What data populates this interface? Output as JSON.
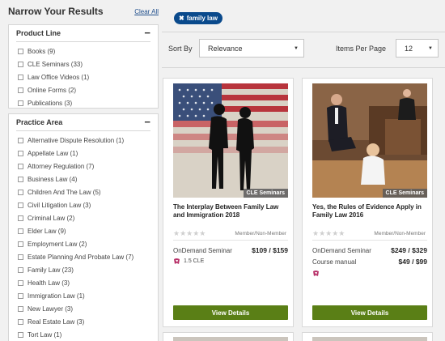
{
  "sidebar": {
    "title": "Narrow Your Results",
    "clear_all": "Clear All",
    "product_line": {
      "title": "Product Line",
      "items": [
        "Books (9)",
        "CLE Seminars (33)",
        "Law Office Videos (1)",
        "Online Forms (2)",
        "Publications (3)"
      ]
    },
    "practice_area": {
      "title": "Practice Area",
      "items": [
        "Alternative Dispute Resolution (1)",
        "Appellate Law (1)",
        "Attorney Regulation (7)",
        "Business Law (4)",
        "Children And The Law (5)",
        "Civil Litigation Law (3)",
        "Criminal Law (2)",
        "Elder Law (9)",
        "Employment Law (2)",
        "Estate Planning And Probate Law (7)",
        "Family Law (23)",
        "Health Law (3)",
        "Immigration Law (1)",
        "New Lawyer (3)",
        "Real Estate Law (3)",
        "Tort Law (1)"
      ]
    }
  },
  "filter_chip": {
    "label": "family law",
    "icon": "close-icon"
  },
  "toolbar": {
    "sort_label": "Sort By",
    "sort_value": "Relevance",
    "ipp_label": "Items Per Page",
    "ipp_value": "12"
  },
  "cards": [
    {
      "badge": "CLE Seminars",
      "title": "The Interplay Between Family Law and Immigration 2018",
      "member_label": "Member/Non-Member",
      "rows": [
        {
          "label": "OnDemand Seminar",
          "price": "$109 / $159"
        }
      ],
      "cle": "1.5 CLE",
      "button": "View Details"
    },
    {
      "badge": "CLE Seminars",
      "title": "Yes, the Rules of Evidence Apply in Family Law 2016",
      "member_label": "Member/Non-Member",
      "rows": [
        {
          "label": "OnDemand Seminar",
          "price": "$249 / $329"
        },
        {
          "label": "Course manual",
          "price": "$49 / $99"
        }
      ],
      "cle": "",
      "button": "View Details"
    }
  ],
  "colors": {
    "brand_blue": "#0a4a8c",
    "button_green": "#5a7f16",
    "cle_icon": "#b8336a"
  }
}
